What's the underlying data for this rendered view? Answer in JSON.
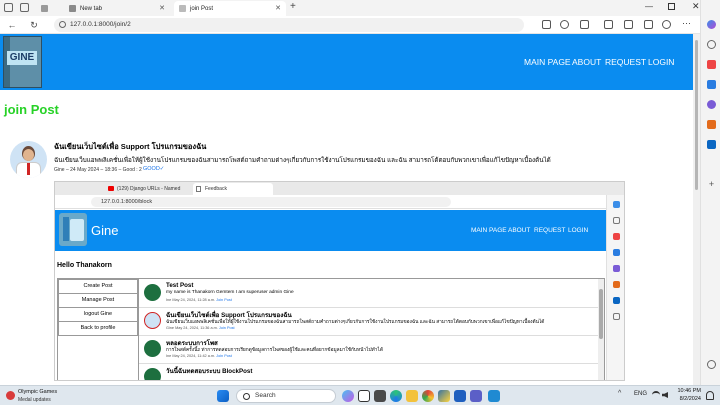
{
  "browser": {
    "tabs": [
      {
        "label": "",
        "active": false
      },
      {
        "label": "New tab",
        "active": false
      },
      {
        "label": "join Post",
        "active": true
      }
    ],
    "url": "127.0.0.1:8000/join/2"
  },
  "site": {
    "logo_text": "GINE",
    "menu": [
      "MAIN PAGE",
      "ABOUT",
      "REQUEST",
      "LOGIN"
    ],
    "accent": "#0a8cf0"
  },
  "page": {
    "title": "join Post",
    "title_color": "#27d227"
  },
  "post": {
    "title": "ฉันเขียนเว็บไซต์เพื่อ Support โปรแกรมของฉัน",
    "body": "ฉันเขียนเว็บแอพพลิเคชั่นเพื่อให้ผู้ใช้งานโปรแกรมของฉันสามารถโพสต์ถามคำถามต่างๆเกี่ยวกับการใช้งานโปรแกรมของฉัน และฉัน สามารถโต้ตอบกับพวกเขาเพื่อแก้ไขปัญหาเบื้องต้นได้",
    "meta": "Gine – 24 May 2024 – 18:36 – Good : 2",
    "good_label": "GOOD✓"
  },
  "embedded": {
    "tabs": [
      "(129) Django URLs - Named URL...",
      "Feedback"
    ],
    "url": "127.0.0.1:8000/block",
    "brand": "Gine",
    "menu": [
      "MAIN PAGE",
      "ABOUT",
      "REQUEST",
      "LOGIN"
    ],
    "hello": "Hello Thanakorn",
    "sidebar": [
      "Create Post",
      "Manage Post",
      "logout Gine",
      "Back to profile"
    ],
    "posts": [
      {
        "title": "Test Post",
        "body": "my name is Thanakorn Gemtem I am superuser admin Gine",
        "meta": "Ine  May 24, 2024, 11:28 a.m.",
        "link": "Join Post"
      },
      {
        "title": "ฉันเขียนเว็บไซต์เพื่อ Support โปรแกรมของฉัน",
        "body": "ฉันเขียนเว็บแอพพลิเคชั่นเพื่อให้ผู้ใช้งานโปรแกรมของฉันสามารถโพสต์ถามคำถามต่างๆเกี่ยวกับการใช้งานโปรแกรมของฉัน และฉัน สามารถโต้ตอบกับพวกเขาเพื่อแก้ไขปัญหาเบื้องต้นได้",
        "meta": "Gine  May 24, 2024, 11:36 a.m.",
        "link": "Join Post"
      },
      {
        "title": "หลอดระบบการโพส",
        "body": "การโพสต์ครั้งนี้2 ท่าการทดสอบการเรียกดูข้อมูลการโพสของผู้ใช้และคนที่อยากข้อมูลมาใช้กับหน้าไปทำได้",
        "meta": "Ine  May 24, 2024, 11:42 a.m.",
        "link": "Join Post"
      },
      {
        "title": "วันนี้ฉันทดสอบระบบ BlockPost",
        "body": "",
        "meta": "",
        "link": ""
      }
    ]
  },
  "taskbar": {
    "weather_title": "Olympic Games",
    "weather_sub": "Medal updates",
    "search_placeholder": "Search",
    "lang": "ENG",
    "time": "10:46 PM",
    "date": "8/2/2024"
  }
}
